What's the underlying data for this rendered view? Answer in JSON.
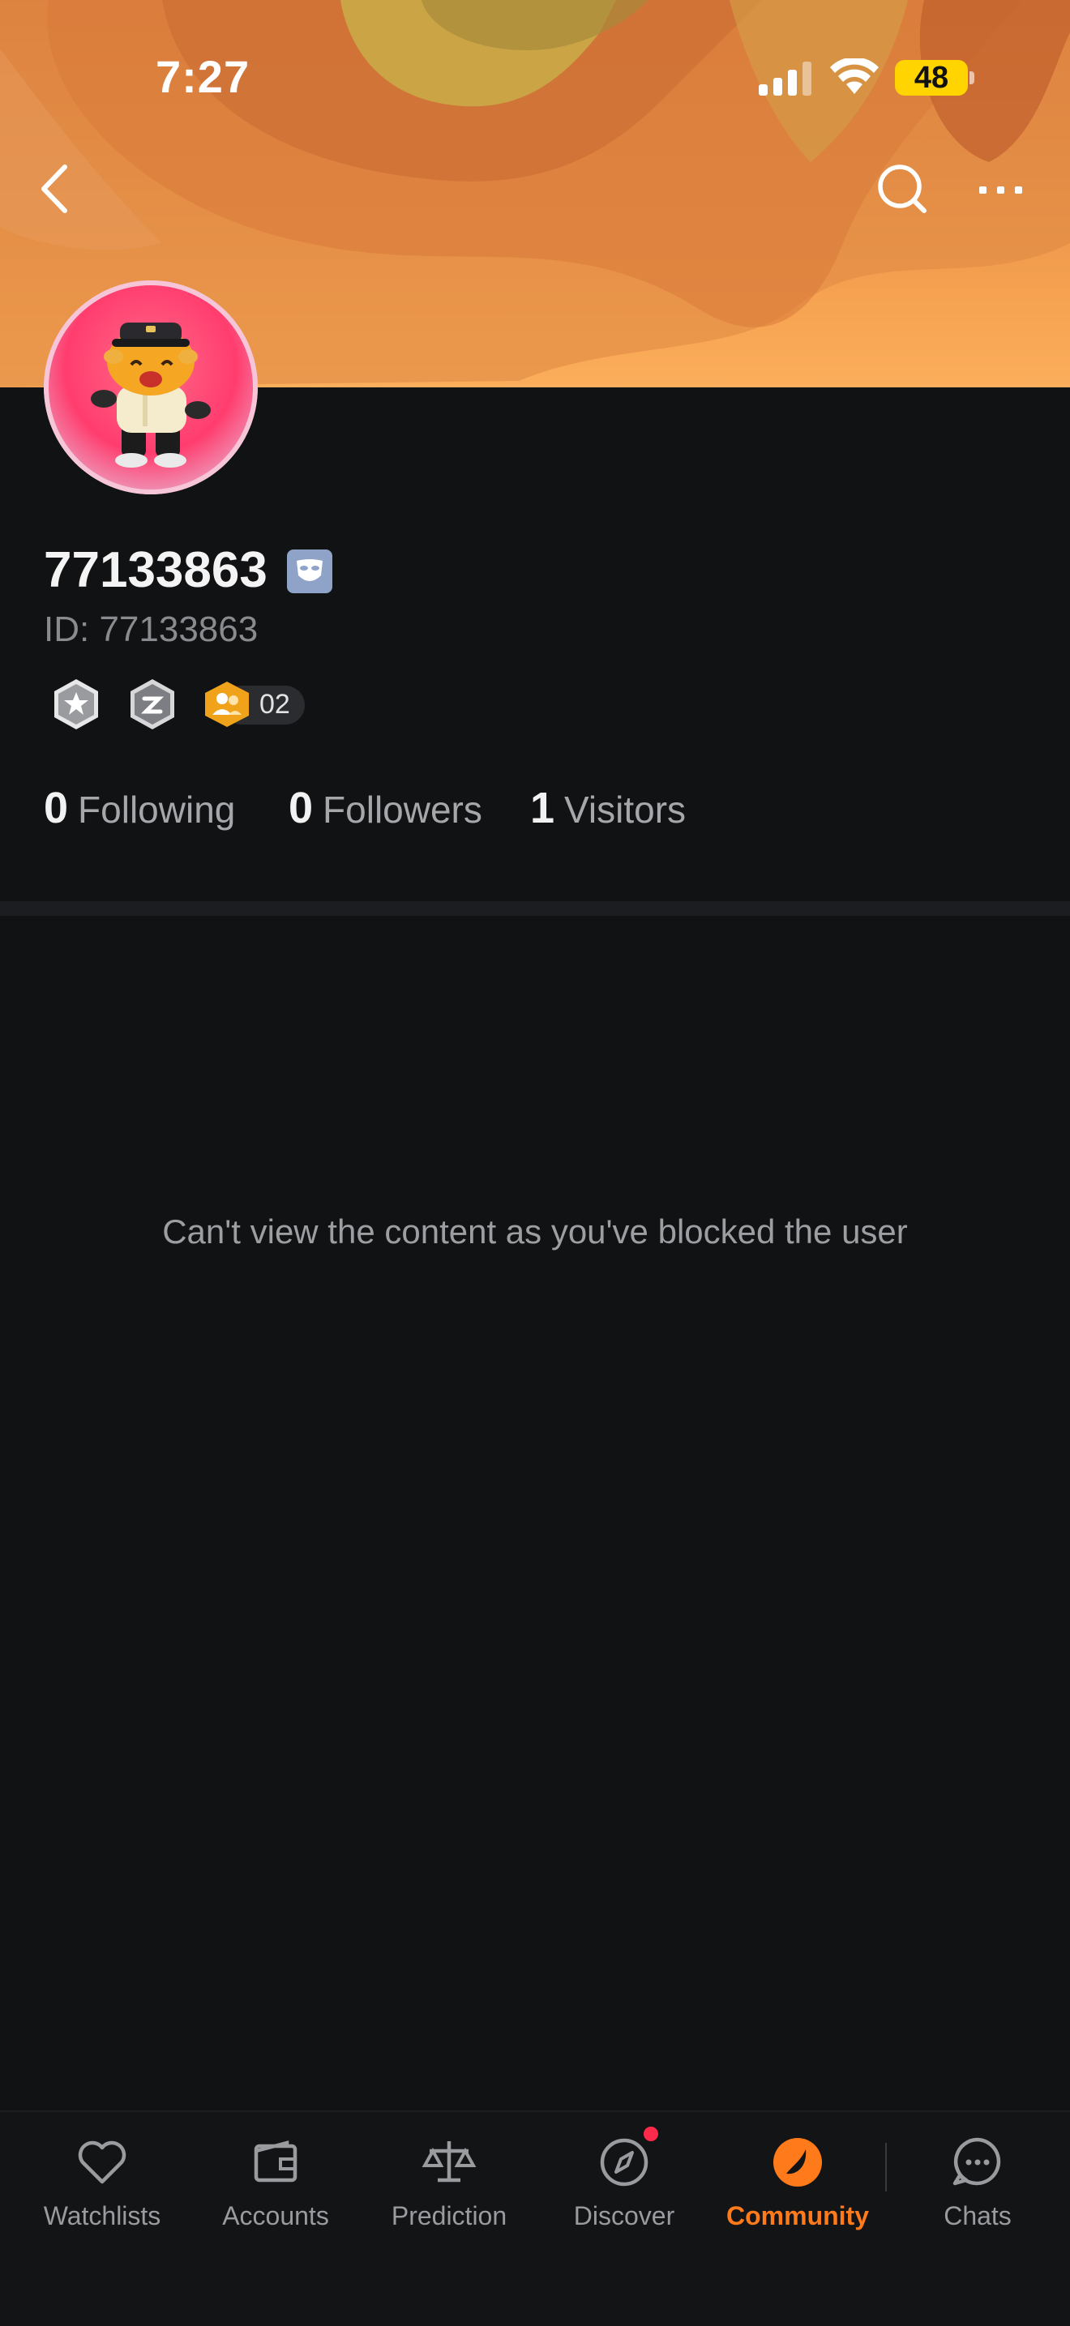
{
  "status_bar": {
    "time": "7:27",
    "battery": "48"
  },
  "header": {
    "back_icon": "chevron-left-icon",
    "search_icon": "search-icon",
    "more_icon": "more-horizontal-icon"
  },
  "profile": {
    "username": "77133863",
    "id_label": "ID: 77133863",
    "badges": [
      {
        "icon": "star-badge-icon"
      },
      {
        "icon": "shield-badge-icon"
      },
      {
        "icon": "group-badge-icon",
        "count": "02"
      }
    ],
    "stats": [
      {
        "value": "0",
        "label": "Following"
      },
      {
        "value": "0",
        "label": "Followers"
      },
      {
        "value": "1",
        "label": "Visitors"
      }
    ]
  },
  "content": {
    "blocked_message": "Can't view the content as you've blocked the user"
  },
  "tabbar": {
    "active": "Community",
    "accent_color": "#ff7a1a",
    "tabs": [
      {
        "label": "Watchlists",
        "icon": "heart-icon"
      },
      {
        "label": "Accounts",
        "icon": "wallet-icon"
      },
      {
        "label": "Prediction",
        "icon": "scale-icon"
      },
      {
        "label": "Discover",
        "icon": "compass-icon"
      },
      {
        "label": "Community",
        "icon": "community-icon"
      },
      {
        "label": "Chats",
        "icon": "chat-bubble-icon"
      }
    ]
  }
}
